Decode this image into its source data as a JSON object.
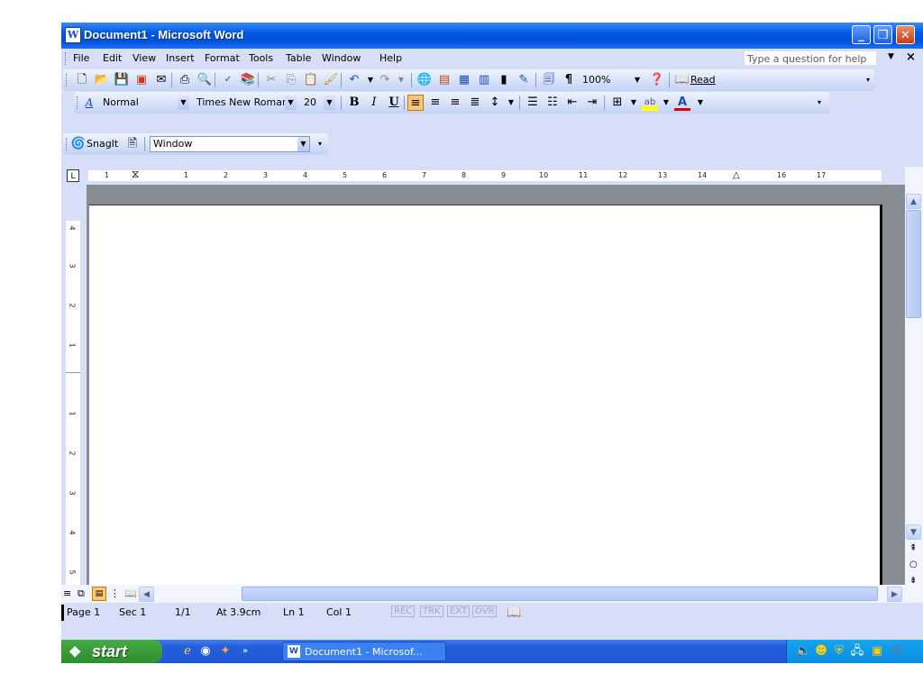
{
  "window": {
    "title": "Document1 - Microsoft Word"
  },
  "menu": {
    "items": [
      "File",
      "Edit",
      "View",
      "Insert",
      "Format",
      "Tools",
      "Table",
      "Window",
      "Help"
    ],
    "help_placeholder": "Type a question for help",
    "close_glyph": "×"
  },
  "standard_toolbar": {
    "zoom": "100%",
    "read_label": "Read"
  },
  "formatting_toolbar": {
    "style": "Normal",
    "font": "Times New Roman",
    "size": "20",
    "bold": "B",
    "italic": "I",
    "underline": "U"
  },
  "snagit_toolbar": {
    "label": "SnagIt",
    "capture_mode": "Window"
  },
  "ruler": {
    "labels": [
      "1",
      "1",
      "2",
      "3",
      "4",
      "5",
      "6",
      "7",
      "8",
      "9",
      "10",
      "11",
      "12",
      "13",
      "14",
      "16",
      "17"
    ]
  },
  "vertical_ruler": {
    "labels": [
      "4",
      "3",
      "2",
      "1",
      "1",
      "2",
      "3",
      "4",
      "5"
    ]
  },
  "status_bar": {
    "page": "Page 1",
    "sec": "Sec 1",
    "pages": "1/1",
    "at": "At 3.9cm",
    "ln": "Ln 1",
    "col": "Col 1",
    "rec": "REC",
    "trk": "TRK",
    "ext": "EXT",
    "ovr": "OVR"
  },
  "taskbar": {
    "start": "start",
    "task_label": "Document1 - Microsof..."
  },
  "icons": {
    "app": "word-icon",
    "new": "new-document-icon",
    "open": "open-folder-icon",
    "save": "save-icon",
    "print": "print-icon",
    "spelling": "spelling-icon",
    "undo": "undo-icon",
    "redo": "redo-icon",
    "help": "help-icon",
    "snagit": "snagit-icon",
    "tray": [
      "speaker-icon",
      "smiley-icon",
      "shield-icon",
      "network-icon",
      "norton-icon",
      "security-icon"
    ]
  }
}
